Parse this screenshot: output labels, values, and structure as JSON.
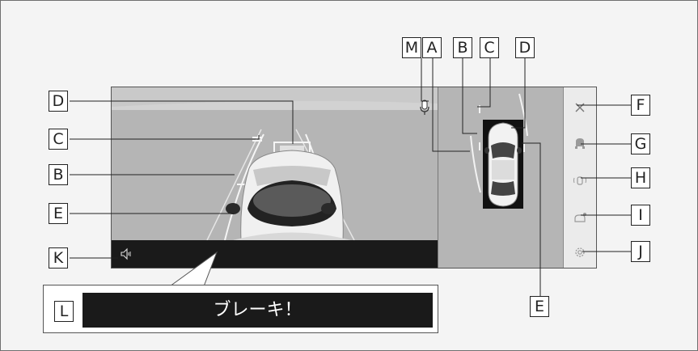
{
  "callouts": {
    "A": "A",
    "B": "B",
    "C": "C",
    "D": "D",
    "E": "E",
    "F": "F",
    "G": "G",
    "H": "H",
    "I": "I",
    "J": "J",
    "K": "K",
    "L": "L",
    "M": "M"
  },
  "popup": {
    "message": "ブレーキ！"
  },
  "icons": {
    "close": "close-icon",
    "camera_view": "rear-camera-view-icon",
    "sensor_view": "vehicle-sensor-view-icon",
    "camera_switch": "camera-switch-icon",
    "settings": "gear-icon",
    "mute": "speaker-mute-icon",
    "mic": "microphone-icon"
  },
  "colors": {
    "camera_bg": "#b9b9b9",
    "guide_line": "#f2f2f2",
    "message_bg": "#1a1a1a",
    "panel_bg": "#ebebeb"
  }
}
